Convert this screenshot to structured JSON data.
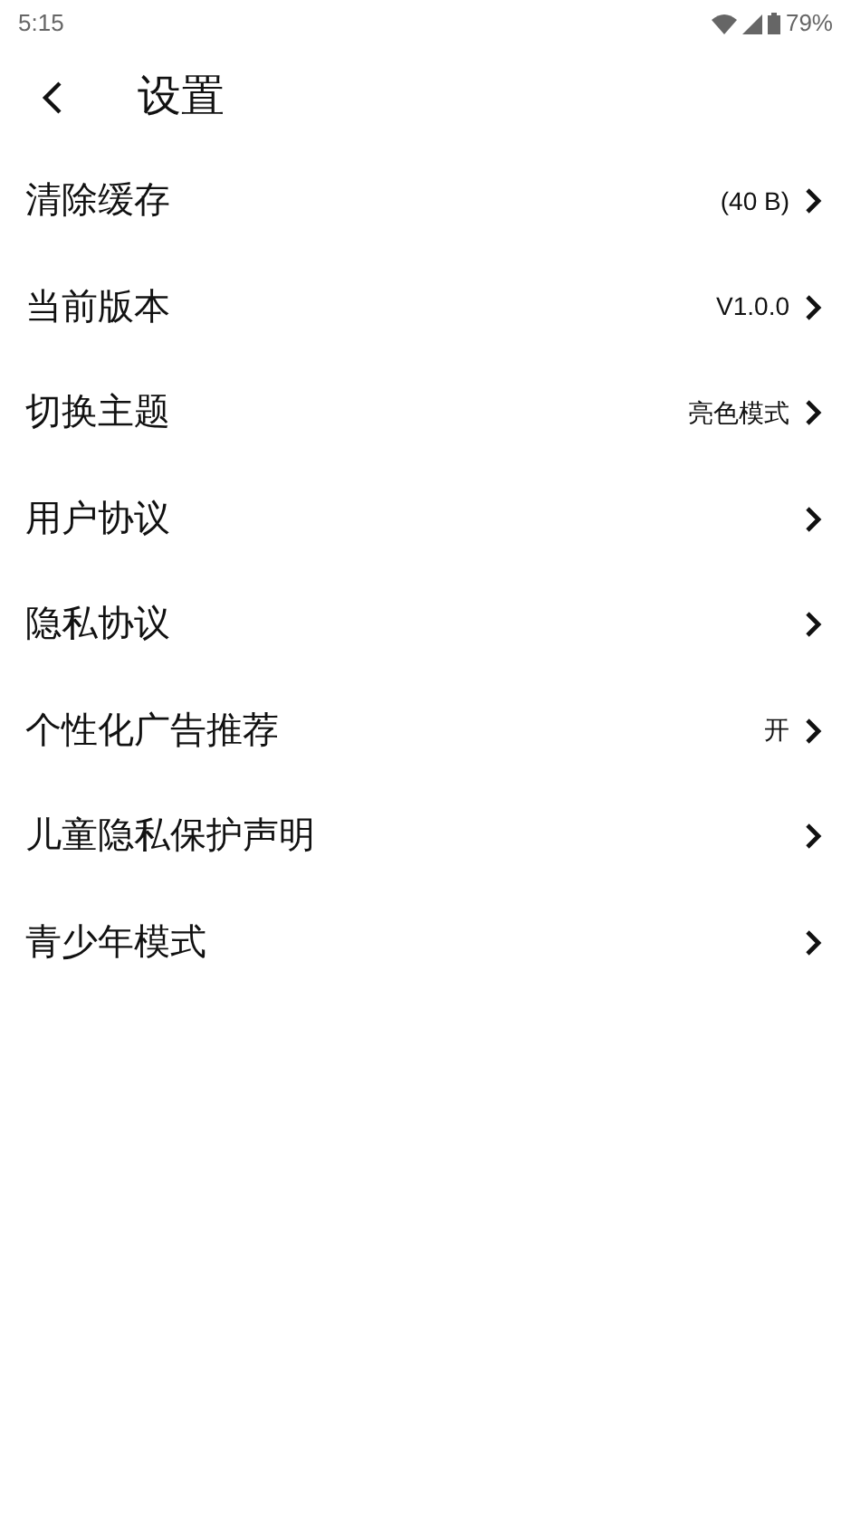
{
  "status_bar": {
    "time": "5:15",
    "battery": "79%"
  },
  "header": {
    "title": "设置"
  },
  "items": [
    {
      "label": "清除缓存",
      "value": "(40 B)"
    },
    {
      "label": "当前版本",
      "value": "V1.0.0"
    },
    {
      "label": "切换主题",
      "value": "亮色模式"
    },
    {
      "label": "用户协议"
    },
    {
      "label": "隐私协议"
    },
    {
      "label": "个性化广告推荐",
      "value": "开"
    },
    {
      "label": "儿童隐私保护声明"
    },
    {
      "label": "青少年模式"
    }
  ]
}
